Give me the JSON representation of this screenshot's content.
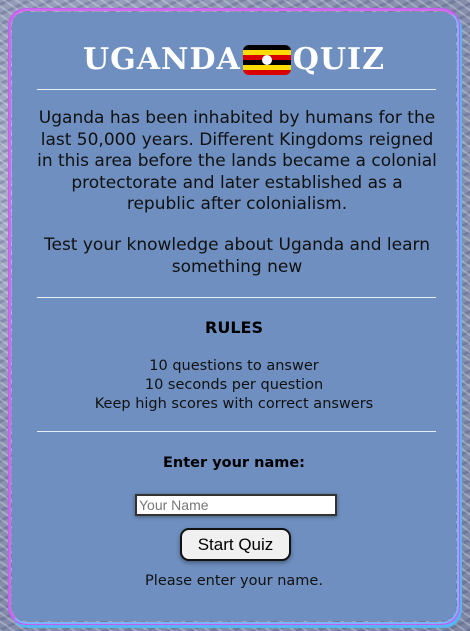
{
  "header": {
    "title_left": "UGANDA",
    "title_right": "QUIZ",
    "flag_icon": "uganda-flag-icon"
  },
  "intro": {
    "text": "Uganda has been inhabited by humans for the last 50,000 years. Different Kingdoms reigned in this area before the lands became a colonial protectorate and later established as a republic after colonialism.",
    "tagline": "Test your knowledge about Uganda and learn something new"
  },
  "rules": {
    "heading": "RULES",
    "items": [
      "10 questions to answer",
      "10 seconds per question",
      "Keep high scores with correct answers"
    ]
  },
  "form": {
    "label": "Enter your name:",
    "input_value": "",
    "input_placeholder": "Your Name",
    "start_label": "Start Quiz",
    "status": "Please enter your name."
  },
  "colors": {
    "card": "#6e8fbf",
    "title": "#ffffff",
    "flag_black": "#000000",
    "flag_yellow": "#fcdc04",
    "flag_red": "#d90000"
  }
}
